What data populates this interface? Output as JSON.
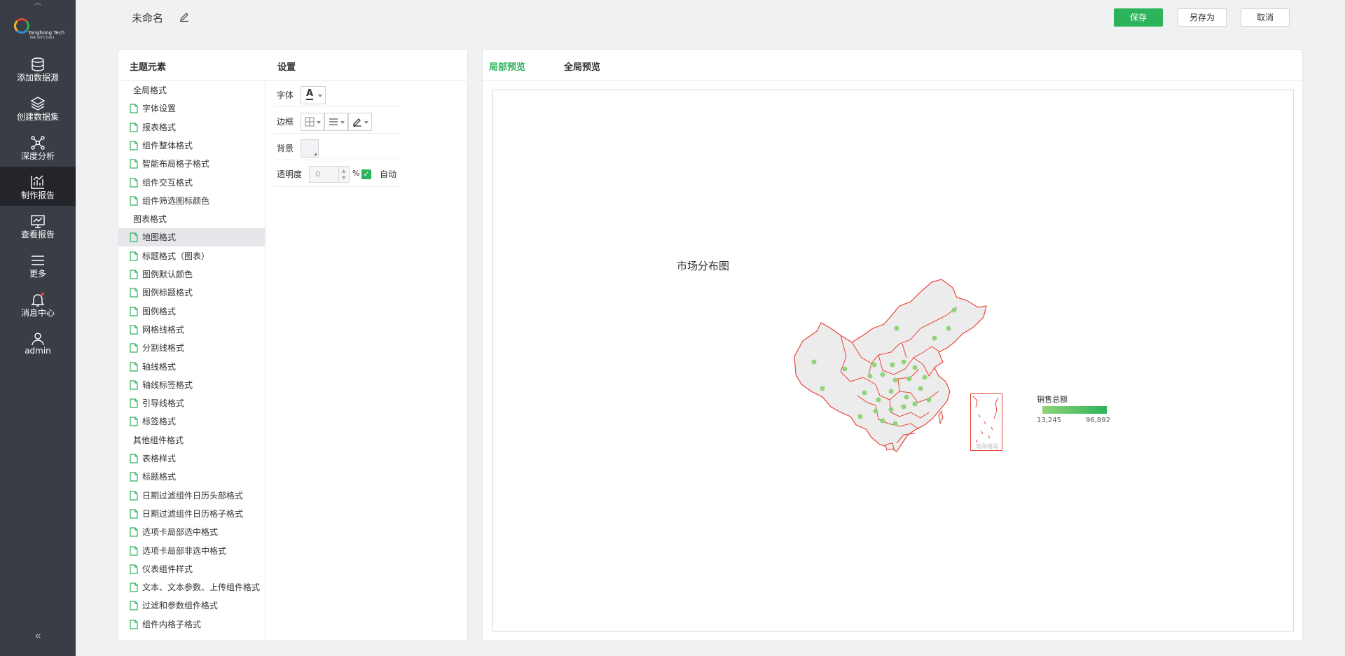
{
  "sidebar": {
    "logo": {
      "line1": "Yonghong Tech",
      "line2": "Talk with Data"
    },
    "items": [
      {
        "label": "添加数据源",
        "icon": "database-icon"
      },
      {
        "label": "创建数据集",
        "icon": "layers-icon"
      },
      {
        "label": "深度分析",
        "icon": "network-icon"
      },
      {
        "label": "制作报告",
        "icon": "chart-icon"
      },
      {
        "label": "查看报告",
        "icon": "monitor-chart-icon"
      },
      {
        "label": "更多",
        "icon": "menu-icon"
      },
      {
        "label": "消息中心",
        "icon": "bell-icon"
      },
      {
        "label": "admin",
        "icon": "user-icon"
      }
    ],
    "active_item": "制作报告",
    "collapse_glyph": "«"
  },
  "header": {
    "title": "未命名",
    "save_label": "保存",
    "save_as_label": "另存为",
    "cancel_label": "取消"
  },
  "left_panel": {
    "tree_header": "主题元素",
    "settings_header": "设置",
    "tree": [
      {
        "type": "group",
        "label": "全局格式"
      },
      {
        "type": "leaf",
        "label": "字体设置"
      },
      {
        "type": "leaf",
        "label": "报表格式"
      },
      {
        "type": "leaf",
        "label": "组件整体格式"
      },
      {
        "type": "leaf",
        "label": "智能布局格子格式"
      },
      {
        "type": "leaf",
        "label": "组件交互格式"
      },
      {
        "type": "leaf",
        "label": "组件筛选图标颜色"
      },
      {
        "type": "group",
        "label": "图表格式"
      },
      {
        "type": "leaf",
        "label": "地图格式",
        "selected": true
      },
      {
        "type": "leaf",
        "label": "标题格式（图表）"
      },
      {
        "type": "leaf",
        "label": "图例默认颜色"
      },
      {
        "type": "leaf",
        "label": "图例标题格式"
      },
      {
        "type": "leaf",
        "label": "图例格式"
      },
      {
        "type": "leaf",
        "label": "网格线格式"
      },
      {
        "type": "leaf",
        "label": "分割线格式"
      },
      {
        "type": "leaf",
        "label": "轴线格式"
      },
      {
        "type": "leaf",
        "label": "轴线标签格式"
      },
      {
        "type": "leaf",
        "label": "引导线格式"
      },
      {
        "type": "leaf",
        "label": "标签格式"
      },
      {
        "type": "group",
        "label": "其他组件格式"
      },
      {
        "type": "leaf",
        "label": "表格样式"
      },
      {
        "type": "leaf",
        "label": "标题格式"
      },
      {
        "type": "leaf",
        "label": "日期过滤组件日历头部格式"
      },
      {
        "type": "leaf",
        "label": "日期过滤组件日历格子格式"
      },
      {
        "type": "leaf",
        "label": "选项卡局部选中格式"
      },
      {
        "type": "leaf",
        "label": "选项卡局部非选中格式"
      },
      {
        "type": "leaf",
        "label": "仪表组件样式"
      },
      {
        "type": "leaf",
        "label": "文本、文本参数、上传组件格式"
      },
      {
        "type": "leaf",
        "label": "过滤和参数组件格式"
      },
      {
        "type": "leaf",
        "label": "组件内格子格式"
      }
    ],
    "settings": {
      "font_label": "字体",
      "font_glyph": "A",
      "border_label": "边框",
      "background_label": "背景",
      "opacity_label": "透明度",
      "opacity_value": "0",
      "opacity_unit": "%",
      "auto_label": "自动",
      "auto_checked": true
    }
  },
  "right_panel": {
    "tabs": [
      "局部预览",
      "全局预览"
    ],
    "active_tab": "局部预览",
    "map": {
      "title": "市场分布图",
      "legend_title": "销售总额",
      "legend_min": "13,245",
      "legend_max": "96,892",
      "legend_color_low": "#8fd47a",
      "legend_color_high": "#2db35b",
      "border_color": "#e8463a",
      "inset_label": "南海诸岛"
    }
  },
  "colors": {
    "accent": "#2db35b",
    "sidebar_bg": "#3a3d45",
    "sidebar_active_bg": "#23252b"
  }
}
